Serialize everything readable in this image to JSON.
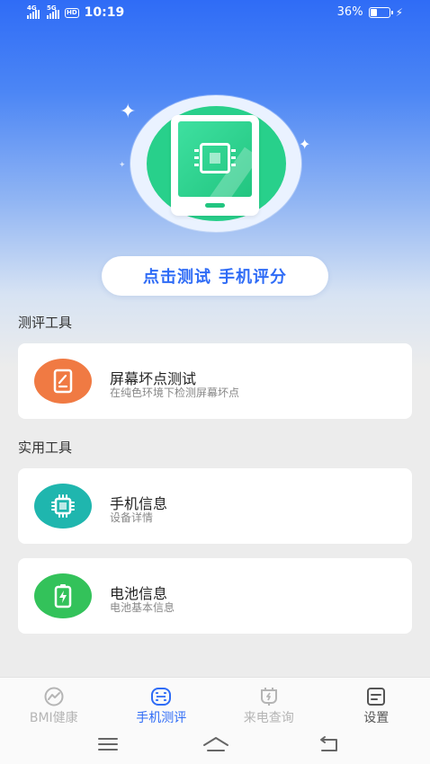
{
  "status_bar": {
    "net1": "4G",
    "net2": "5G",
    "hd": "HD",
    "time": "10:19",
    "battery_percent": "36%",
    "battery_level": 0.36,
    "charging_icon": "bolt-icon"
  },
  "hero": {
    "illustration": "phone-chip-illustration",
    "cta_part1": "点击测试",
    "cta_part2": "手机评分"
  },
  "sections": {
    "evaluation_title": "测评工具",
    "utility_title": "实用工具"
  },
  "cards": {
    "screen_test": {
      "title": "屏幕坏点测试",
      "subtitle": "在纯色环境下检测屏幕坏点",
      "icon": "document-icon",
      "color": "#f07a43"
    },
    "phone_info": {
      "title": "手机信息",
      "subtitle": "设备详情",
      "icon": "chip-icon",
      "color": "#1fb6ae"
    },
    "battery_info": {
      "title": "电池信息",
      "subtitle": "电池基本信息",
      "icon": "battery-icon",
      "color": "#33c25a"
    }
  },
  "tabs": [
    {
      "label": "BMI健康",
      "icon": "health-icon",
      "active": false
    },
    {
      "label": "手机测评",
      "icon": "scan-icon",
      "active": true
    },
    {
      "label": "来电查询",
      "icon": "plug-icon",
      "active": false
    },
    {
      "label": "设置",
      "icon": "settings-icon",
      "active": false
    }
  ],
  "colors": {
    "accent": "#2f6cf6",
    "hero_green": "#28d08b"
  }
}
